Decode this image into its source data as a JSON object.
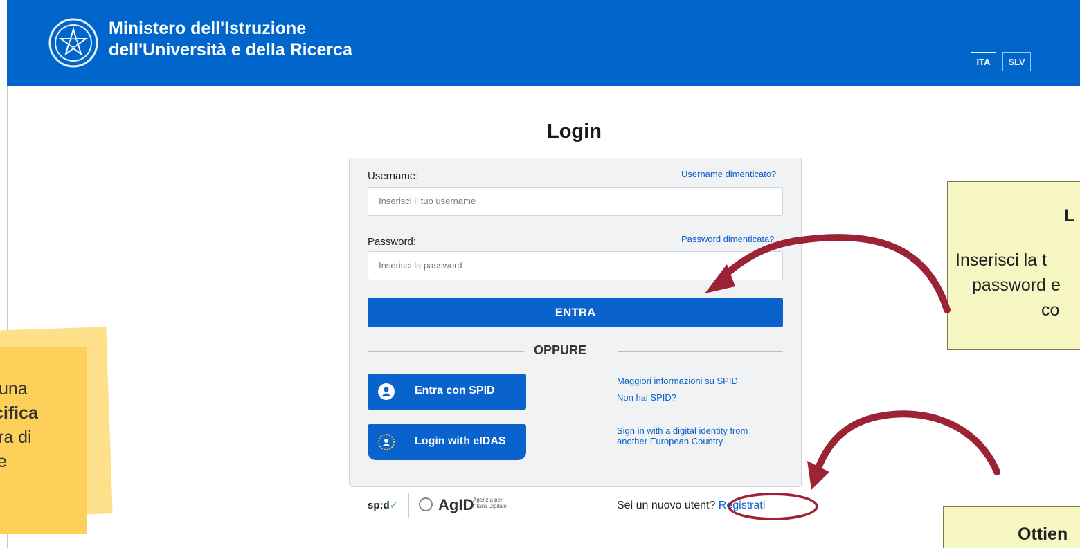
{
  "header": {
    "ministry_line1": "Ministero dell'Istruzione",
    "ministry_line2": "dell'Università e della Ricerca",
    "languages": [
      "ITA",
      "SLV"
    ],
    "brand_color": "#0066cc"
  },
  "login": {
    "title": "Login",
    "username_label": "Username:",
    "username_forgot": "Username dimenticato?",
    "username_placeholder": "Inserisci il tuo username",
    "password_label": "Password:",
    "password_forgot": "Password dimenticata?",
    "password_placeholder": "Inserisci la password",
    "submit": "ENTRA",
    "divider": "OPPURE",
    "spid_button": "Entra con SPID",
    "spid_more_info": "Maggiori informazioni su SPID",
    "spid_missing": "Non hai SPID?",
    "eidas_button": "Login with eIDAS",
    "eidas_info_line1": "Sign in with a digital identity from",
    "eidas_info_line2": "another European Country",
    "new_user_text": "Sei un nuovo utent",
    "new_user_qmark": "?",
    "register_link": "Registrati"
  },
  "footer_logos": {
    "spid_logo": "sp:d",
    "agid": "AgID",
    "agid_sub_line1": "Agenzia per",
    "agid_sub_line2": "l'Italia Digitale"
  },
  "left_note": {
    "line1": "una",
    "line2": "cifica",
    "line3": "ra di",
    "line4": "e"
  },
  "callout_login": {
    "line1": "L",
    "line2": "Inserisci la t",
    "line3": "password e",
    "line4": "co"
  },
  "callout_register": {
    "line1": "Ottien"
  },
  "colors": {
    "accent": "#0a63cc",
    "annotation_arrow": "#9b2335",
    "note_yellow": "#fdd05a",
    "callout_bg": "#f7f7c4"
  }
}
